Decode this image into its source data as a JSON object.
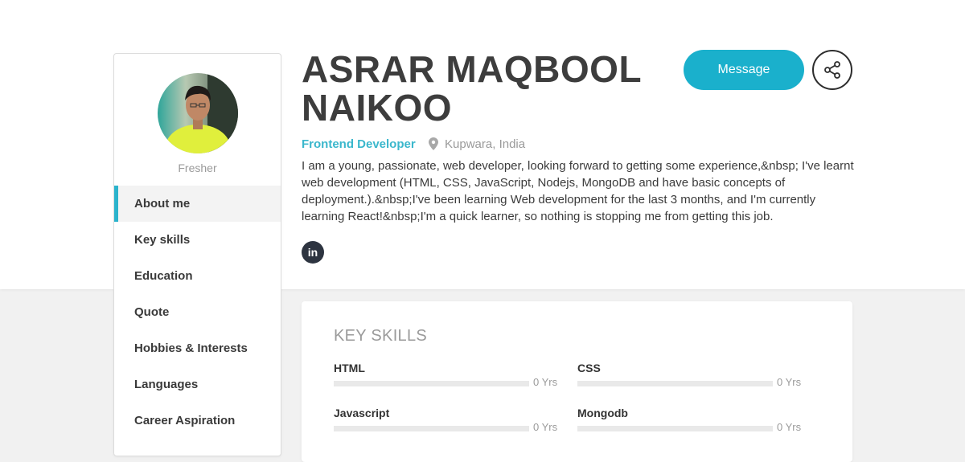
{
  "profile": {
    "name": "ASRAR MAQBOOL NAIKOO",
    "status": "Fresher",
    "role": "Frontend Developer",
    "location": "Kupwara, India",
    "about": "I am a young, passionate, web developer, looking forward to getting some experience,&nbsp; I've learnt web development (HTML, CSS, JavaScript, Nodejs, MongoDB and have basic concepts of deployment.).&nbsp;I've been learning Web development for the last 3 months, and I'm currently learning React!&nbsp;I'm a quick learner, so nothing is stopping me from getting this job.",
    "linkedin_label": "in"
  },
  "actions": {
    "message_label": "Message"
  },
  "sidebar": {
    "items": [
      {
        "label": "About me",
        "active": true
      },
      {
        "label": "Key skills",
        "active": false
      },
      {
        "label": "Education",
        "active": false
      },
      {
        "label": "Quote",
        "active": false
      },
      {
        "label": "Hobbies & Interests",
        "active": false
      },
      {
        "label": "Languages",
        "active": false
      },
      {
        "label": "Career Aspiration",
        "active": false
      }
    ]
  },
  "skills": {
    "title": "KEY SKILLS",
    "items": [
      {
        "name": "HTML",
        "years": "0 Yrs",
        "level": 0
      },
      {
        "name": "CSS",
        "years": "0 Yrs",
        "level": 0
      },
      {
        "name": "Javascript",
        "years": "0 Yrs",
        "level": 0
      },
      {
        "name": "Mongodb",
        "years": "0 Yrs",
        "level": 0
      }
    ]
  },
  "icons": {
    "share": "share-icon",
    "location": "map-pin-icon",
    "linkedin": "linkedin-icon"
  },
  "colors": {
    "accent": "#1ab0cc",
    "role": "#3ab7cc",
    "name": "#3d3d3d"
  }
}
